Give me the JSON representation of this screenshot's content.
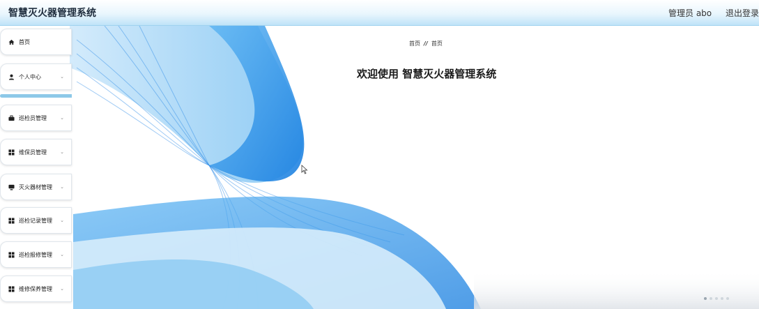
{
  "header": {
    "title": "智慧灭火器管理系统",
    "user_label": "管理员 abo",
    "logout": "退出登录"
  },
  "sidebar": {
    "items": [
      {
        "label": "首页",
        "icon": "home-icon",
        "expandable": false
      },
      {
        "label": "个人中心",
        "icon": "person-icon",
        "expandable": true
      },
      {
        "label": "巡检员管理",
        "icon": "briefcase-icon",
        "expandable": true
      },
      {
        "label": "维保员管理",
        "icon": "grid-icon",
        "expandable": true
      },
      {
        "label": "灭火器材管理",
        "icon": "monitor-icon",
        "expandable": true
      },
      {
        "label": "巡检记录管理",
        "icon": "grid-icon",
        "expandable": true
      },
      {
        "label": "巡检报修管理",
        "icon": "grid-icon",
        "expandable": true
      },
      {
        "label": "维修保养管理",
        "icon": "grid-icon",
        "expandable": true
      }
    ]
  },
  "main": {
    "breadcrumb": {
      "home": "首页",
      "separator": "//",
      "current": "首页"
    },
    "welcome": "欢迎使用 智慧灭火器管理系统"
  },
  "colors": {
    "accent": "#1e88e5",
    "header_gradient_end": "#bfe3f8",
    "sidebar_accent": "#8dc8e8"
  }
}
